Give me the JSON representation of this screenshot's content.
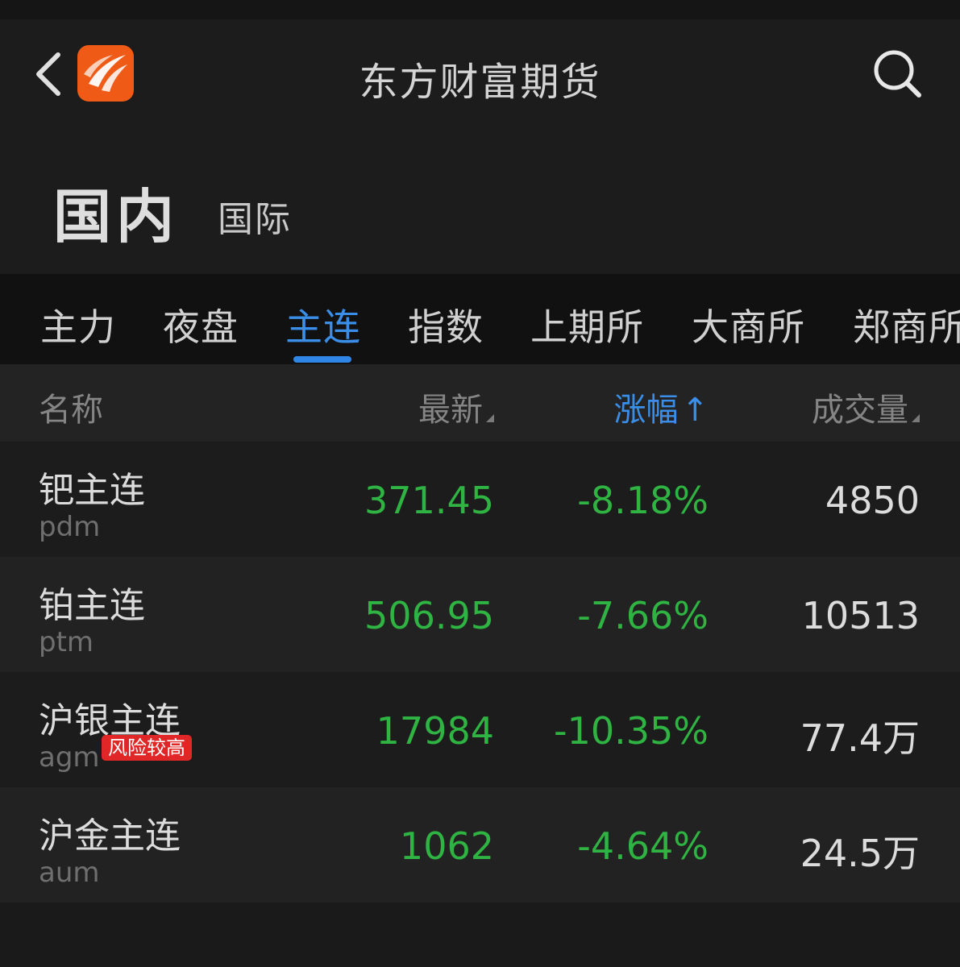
{
  "header": {
    "title": "东方财富期货",
    "back_icon": "chevron-left-icon",
    "logo_icon": "eastmoney-logo",
    "search_icon": "search-icon"
  },
  "market_tabs": {
    "active": "国内",
    "other": "国际"
  },
  "category_tabs": [
    "主力",
    "夜盘",
    "主连",
    "指数",
    "上期所",
    "大商所",
    "郑商所"
  ],
  "active_category": "主连",
  "table": {
    "headers": {
      "name": "名称",
      "latest": "最新",
      "change": "涨幅",
      "change_sort_icon": "↑",
      "volume": "成交量"
    },
    "rows": [
      {
        "name": "钯主连",
        "code": "pdm",
        "badge": "",
        "latest": "371.45",
        "change": "-8.18%",
        "volume": "4850"
      },
      {
        "name": "铂主连",
        "code": "ptm",
        "badge": "",
        "latest": "506.95",
        "change": "-7.66%",
        "volume": "10513"
      },
      {
        "name": "沪银主连",
        "code": "agm",
        "badge": "风险较高",
        "latest": "17984",
        "change": "-10.35%",
        "volume": "77.4万"
      },
      {
        "name": "沪金主连",
        "code": "aum",
        "badge": "",
        "latest": "1062",
        "change": "-4.64%",
        "volume": "24.5万"
      }
    ]
  },
  "colors": {
    "accent": "#3b8ee8",
    "down": "#2fb342",
    "badge": "#e02626",
    "logo": "#ef5a17"
  }
}
